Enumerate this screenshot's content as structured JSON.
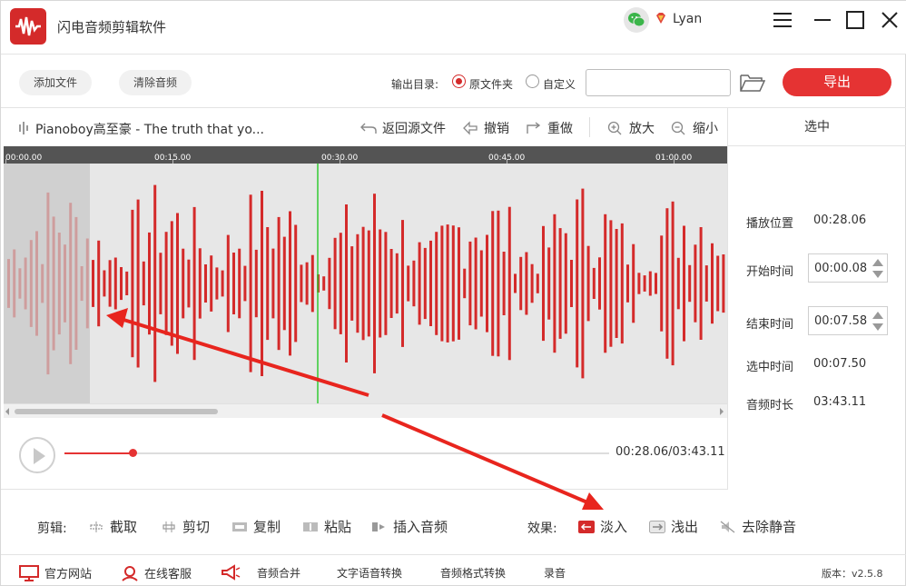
{
  "app": {
    "title": "闪电音频剪辑软件",
    "user": "Lyan"
  },
  "toolbar": {
    "add_file": "添加文件",
    "clear_audio": "清除音频",
    "output_label": "输出目录:",
    "opt_source": "原文件夹",
    "opt_custom": "自定义",
    "path_value": "",
    "export": "导出"
  },
  "track": {
    "name": "Pianoboy高至豪 - The truth that yo...",
    "revert": "返回源文件",
    "undo": "撤销",
    "redo": "重做",
    "zoom_in": "放大",
    "zoom_out": "缩小"
  },
  "timeline": {
    "ticks": [
      "00:00.00",
      "00:15.00",
      "00:30.00",
      "00:45.00",
      "01:00.00"
    ]
  },
  "panel": {
    "title": "选中",
    "play_pos_label": "播放位置",
    "play_pos": "00:28.06",
    "start_label": "开始时间",
    "start": "00:00.08",
    "end_label": "结束时间",
    "end": "00:07.58",
    "sel_label": "选中时间",
    "sel": "00:07.50",
    "dur_label": "音频时长",
    "dur": "03:43.11"
  },
  "player": {
    "time": "00:28.06/03:43.11",
    "progress_fraction": 0.1257
  },
  "edit": {
    "label": "剪辑:",
    "crop": "截取",
    "cut": "剪切",
    "copy": "复制",
    "paste": "粘贴",
    "insert": "插入音频",
    "fx_label": "效果:",
    "fade_in": "淡入",
    "fade_out": "浅出",
    "remove_silence": "去除静音"
  },
  "footer": {
    "website": "官方网站",
    "service": "在线客服",
    "merge": "音频合并",
    "tts": "文字语音转换",
    "convert": "音频格式转换",
    "record": "录音",
    "version": "版本：v2.5.8"
  },
  "colors": {
    "accent": "#e53333",
    "wave": "#d42a2a",
    "playhead": "#33cc33"
  }
}
